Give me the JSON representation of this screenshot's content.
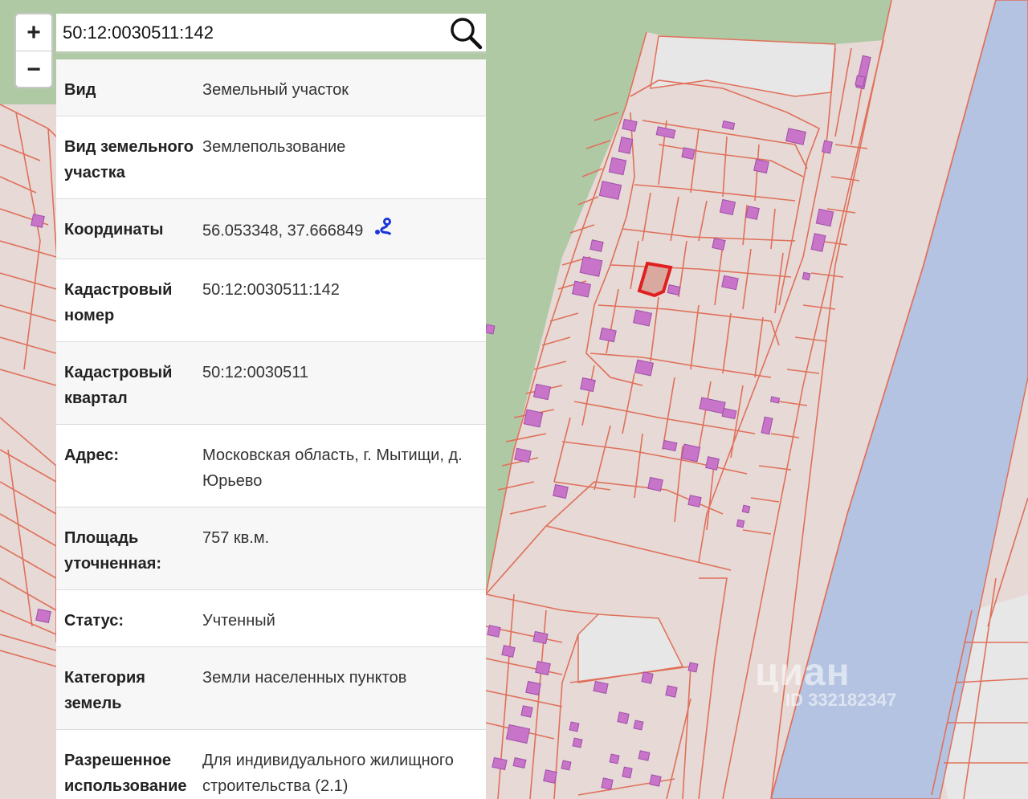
{
  "search": {
    "value": "50:12:0030511:142"
  },
  "zoom": {
    "in_label": "+",
    "out_label": "−"
  },
  "info": [
    {
      "label": "Вид",
      "value": "Земельный участок"
    },
    {
      "label": "Вид земельного участка",
      "value": "Землепользование"
    },
    {
      "label": "Координаты",
      "value": "56.053348, 37.666849",
      "icon": "route-icon"
    },
    {
      "label": "Кадастровый номер",
      "value": "50:12:0030511:142"
    },
    {
      "label": "Кадастровый квартал",
      "value": "50:12:0030511"
    },
    {
      "label": "Адрес:",
      "value": "Московская область, г. Мытищи, д. Юрьево"
    },
    {
      "label": "Площадь уточненная:",
      "value": "757 кв.м."
    },
    {
      "label": "Статус:",
      "value": "Учтенный"
    },
    {
      "label": "Категория земель",
      "value": "Земли населенных пунктов"
    },
    {
      "label": "Разрешенное использование",
      "value": "Для индивидуального жилищного строительства (2.1)"
    }
  ],
  "watermark": {
    "brand": "циан",
    "id": "ID 332182347"
  },
  "colors": {
    "parcel_fill": "#e6d9d6",
    "parcel_stroke": "#e0705a",
    "forest": "#b0c9a5",
    "river": "#b4c3e2",
    "building": "#c774c9",
    "highlight": "#e02020"
  }
}
